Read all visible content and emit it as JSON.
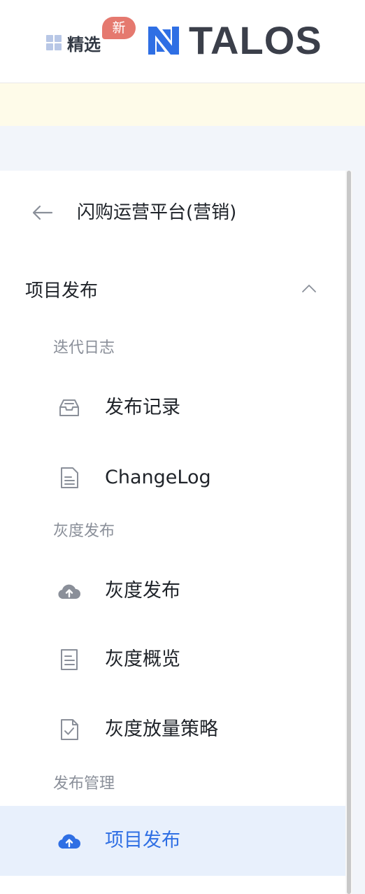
{
  "header": {
    "featured_label": "精选",
    "new_badge": "新",
    "logo_text": "TALOS"
  },
  "sidebar": {
    "back_label": "闪购运营平台(营销)",
    "group_title": "项目发布",
    "sections": [
      {
        "label": "迭代日志"
      },
      {
        "label": "灰度发布"
      },
      {
        "label": "发布管理"
      }
    ],
    "items": [
      {
        "label": "发布记录",
        "icon": "inbox-icon"
      },
      {
        "label": "ChangeLog",
        "icon": "document-icon"
      },
      {
        "label": "灰度发布",
        "icon": "cloud-upload-icon"
      },
      {
        "label": "灰度概览",
        "icon": "document-icon"
      },
      {
        "label": "灰度放量策略",
        "icon": "document-check-icon"
      },
      {
        "label": "项目发布",
        "icon": "cloud-upload-icon",
        "active": true
      }
    ]
  },
  "colors": {
    "accent": "#2f6fe4",
    "active_bg": "#e8f0fc",
    "badge": "#e5796f",
    "notice_bg": "#fefbe9",
    "page_bg": "#f2f5fa"
  }
}
